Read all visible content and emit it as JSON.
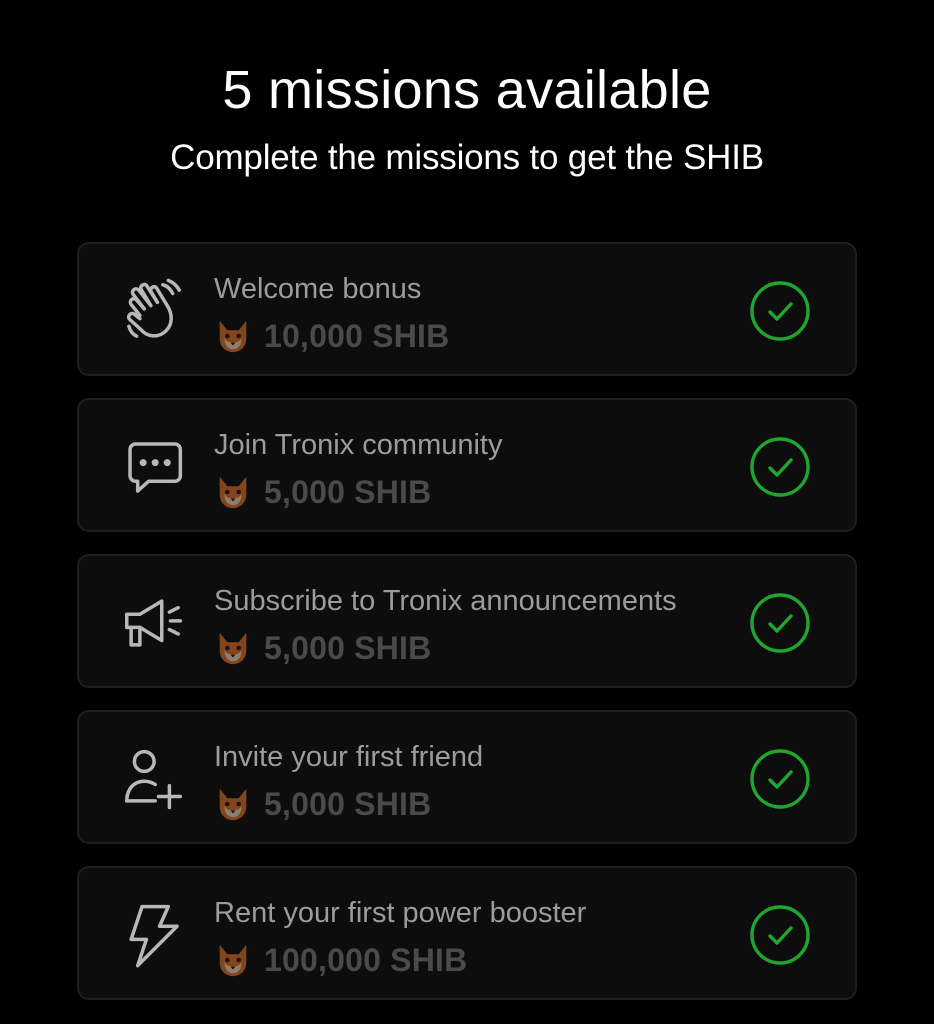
{
  "header": {
    "title": "5 missions available",
    "subtitle": "Complete the missions to get the SHIB"
  },
  "colors": {
    "background": "#000000",
    "card_background": "#0d0d0d",
    "card_border": "#1f1f1f",
    "completed_check": "#1fa62e",
    "mission_name": "#9c9c9c",
    "reward_amount": "#4a4a4a"
  },
  "missions": [
    {
      "name": "Welcome bonus",
      "reward": "10,000 SHIB",
      "icon": "waving-hand-icon",
      "status": "completed"
    },
    {
      "name": "Join Tronix community",
      "reward": "5,000 SHIB",
      "icon": "chat-bubble-icon",
      "status": "completed"
    },
    {
      "name": "Subscribe to Tronix announcements",
      "reward": "5,000 SHIB",
      "icon": "megaphone-icon",
      "status": "completed"
    },
    {
      "name": "Invite your first friend",
      "reward": "5,000 SHIB",
      "icon": "add-user-icon",
      "status": "completed"
    },
    {
      "name": "Rent your first power booster",
      "reward": "100,000 SHIB",
      "icon": "lightning-bolt-icon",
      "status": "completed"
    }
  ],
  "reward_token_icon": "shiba-inu-token-icon",
  "status_icon": "check-circle-icon"
}
